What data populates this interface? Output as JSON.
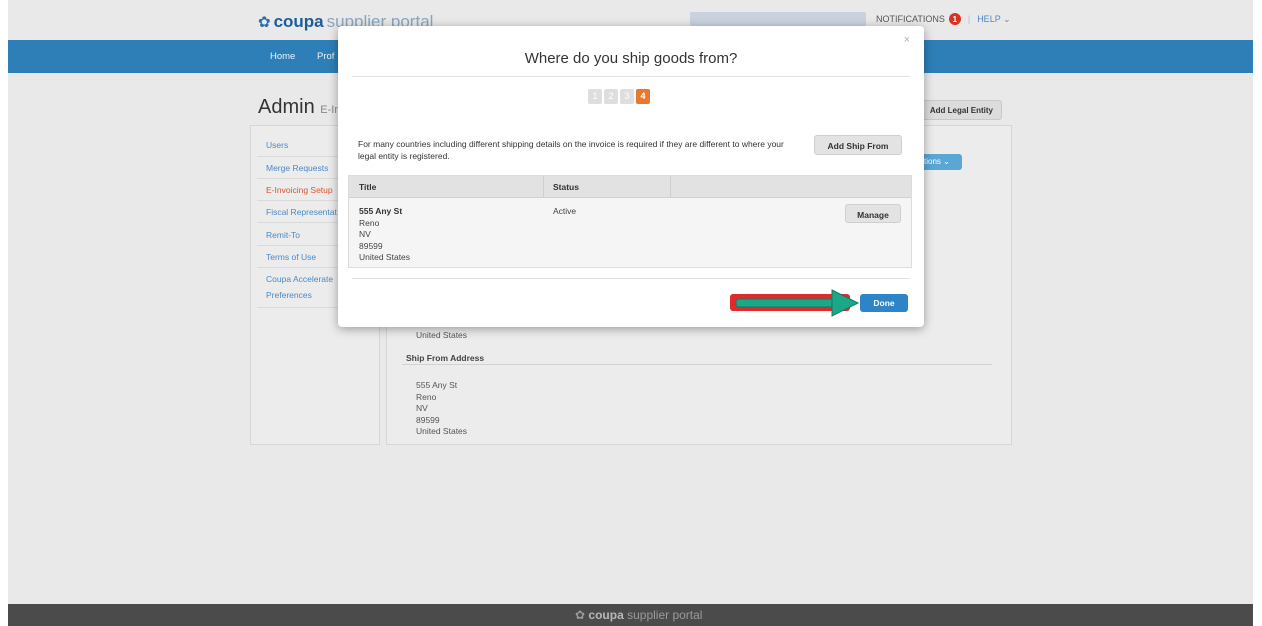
{
  "brand": {
    "logo_bold": "coupa",
    "logo_light": "supplier portal"
  },
  "header": {
    "notifications_label": "NOTIFICATIONS",
    "notifications_count": "1",
    "help_label": "HELP"
  },
  "nav": {
    "items": [
      "Home",
      "Prof"
    ]
  },
  "page": {
    "title": "Admin",
    "subtitle": "E-In",
    "add_legal_entity_label": "Add Legal Entity",
    "actions_label": "ctions"
  },
  "sidebar": {
    "items": [
      {
        "label": "Users"
      },
      {
        "label": "Merge Requests"
      },
      {
        "label": "E-Invoicing Setup"
      },
      {
        "label": "Fiscal Representat"
      },
      {
        "label": "Remit-To"
      },
      {
        "label": "Terms of Use"
      },
      {
        "label": "Coupa Accelerate"
      },
      {
        "label": "Preferences"
      }
    ]
  },
  "background_content": {
    "country_line": "United States",
    "ship_from_heading": "Ship From Address",
    "ship_from_address": [
      "555 Any St",
      "Reno",
      "NV",
      "89599",
      "United States"
    ]
  },
  "modal": {
    "title": "Where do you ship goods from?",
    "close_symbol": "×",
    "steps": [
      "1",
      "2",
      "3",
      "4"
    ],
    "active_step": 4,
    "intro_text": "For many countries including different shipping details on the invoice is required if they are different to where your legal entity is registered.",
    "add_ship_from_label": "Add Ship From",
    "table": {
      "columns": [
        "Title",
        "Status"
      ],
      "rows": [
        {
          "address": [
            "555 Any St",
            "Reno",
            "NV",
            "89599",
            "United States"
          ],
          "status": "Active",
          "action_label": "Manage"
        }
      ]
    },
    "done_label": "Done"
  },
  "colors": {
    "nav_blue": "#2e7fb8",
    "step_active": "#e7782e",
    "done_button": "#2d84c6",
    "highlight_red": "#e12a2a",
    "arrow_teal": "#1aa889"
  }
}
